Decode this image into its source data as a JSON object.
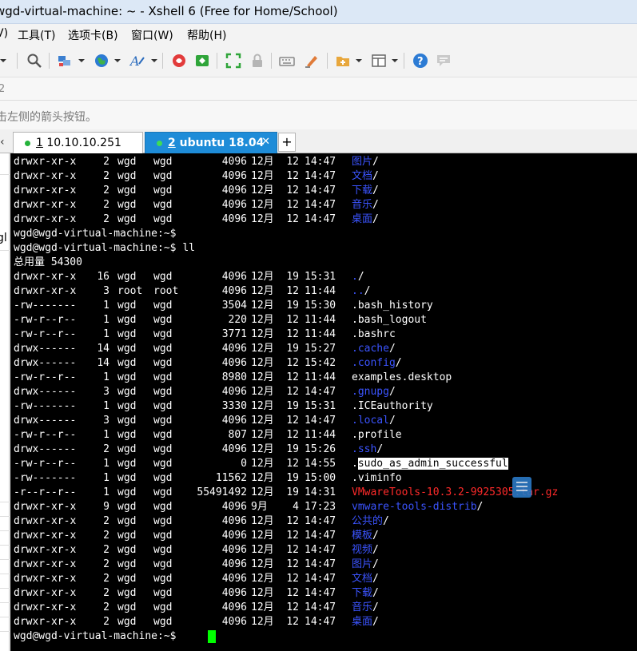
{
  "window": {
    "title": "wgd-virtual-machine: ~ - Xshell 6 (Free for Home/School)"
  },
  "menu": {
    "items": [
      "V)",
      "工具(T)",
      "选项卡(B)",
      "窗口(W)",
      "帮助(H)"
    ]
  },
  "toolbar": {
    "icons": [
      "dropdown-arrow",
      "search-icon",
      "session-properties-icon",
      "globe-icon",
      "font-icon",
      "xftp-icon",
      "xftp-green-icon",
      "fullscreen-icon",
      "lock-icon",
      "keyboard-icon",
      "highlighter-icon",
      "new-tab-icon",
      "layout-icon",
      "help-icon",
      "chat-icon"
    ]
  },
  "addressbar": {
    "text": "2"
  },
  "hint": {
    "text": "击左侧的箭头按钮。"
  },
  "tabs": [
    {
      "number": "1",
      "label": " 10.10.10.251",
      "close": "✕",
      "active": false
    },
    {
      "number": "2",
      "label": " ubuntu 18.04",
      "close": "✕",
      "active": true
    }
  ],
  "tab_add_label": "+",
  "tab_left_arrow": "‹",
  "sidepanel": {
    "partial_text": "gl"
  },
  "terminal": {
    "lines": [
      {
        "perm": "drwxr-xr-x",
        "links": "2",
        "owner": "wgd",
        "group": "wgd",
        "size": "4096",
        "month": "12月",
        "day": "12",
        "time": "14:47",
        "name": "图片",
        "suffix": "/",
        "type": "dir"
      },
      {
        "perm": "drwxr-xr-x",
        "links": "2",
        "owner": "wgd",
        "group": "wgd",
        "size": "4096",
        "month": "12月",
        "day": "12",
        "time": "14:47",
        "name": "文档",
        "suffix": "/",
        "type": "dir"
      },
      {
        "perm": "drwxr-xr-x",
        "links": "2",
        "owner": "wgd",
        "group": "wgd",
        "size": "4096",
        "month": "12月",
        "day": "12",
        "time": "14:47",
        "name": "下载",
        "suffix": "/",
        "type": "dir"
      },
      {
        "perm": "drwxr-xr-x",
        "links": "2",
        "owner": "wgd",
        "group": "wgd",
        "size": "4096",
        "month": "12月",
        "day": "12",
        "time": "14:47",
        "name": "音乐",
        "suffix": "/",
        "type": "dir"
      },
      {
        "perm": "drwxr-xr-x",
        "links": "2",
        "owner": "wgd",
        "group": "wgd",
        "size": "4096",
        "month": "12月",
        "day": "12",
        "time": "14:47",
        "name": "桌面",
        "suffix": "/",
        "type": "dir"
      },
      {
        "text": "wgd@wgd-virtual-machine:~$"
      },
      {
        "text": "wgd@wgd-virtual-machine:~$ ll"
      },
      {
        "text": "总用量 54300"
      },
      {
        "perm": "drwxr-xr-x",
        "links": "16",
        "owner": "wgd",
        "group": "wgd",
        "size": "4096",
        "month": "12月",
        "day": "19",
        "time": "15:31",
        "name": ".",
        "suffix": "/",
        "type": "dir"
      },
      {
        "perm": "drwxr-xr-x",
        "links": "3",
        "owner": "root",
        "group": "root",
        "size": "4096",
        "month": "12月",
        "day": "12",
        "time": "11:44",
        "name": "..",
        "suffix": "/",
        "type": "dir"
      },
      {
        "perm": "-rw-------",
        "links": "1",
        "owner": "wgd",
        "group": "wgd",
        "size": "3504",
        "month": "12月",
        "day": "19",
        "time": "15:30",
        "name": ".bash_history",
        "suffix": "",
        "type": "file"
      },
      {
        "perm": "-rw-r--r--",
        "links": "1",
        "owner": "wgd",
        "group": "wgd",
        "size": "220",
        "month": "12月",
        "day": "12",
        "time": "11:44",
        "name": ".bash_logout",
        "suffix": "",
        "type": "file"
      },
      {
        "perm": "-rw-r--r--",
        "links": "1",
        "owner": "wgd",
        "group": "wgd",
        "size": "3771",
        "month": "12月",
        "day": "12",
        "time": "11:44",
        "name": ".bashrc",
        "suffix": "",
        "type": "file"
      },
      {
        "perm": "drwx------",
        "links": "14",
        "owner": "wgd",
        "group": "wgd",
        "size": "4096",
        "month": "12月",
        "day": "19",
        "time": "15:27",
        "name": ".cache",
        "suffix": "/",
        "type": "dir"
      },
      {
        "perm": "drwx------",
        "links": "14",
        "owner": "wgd",
        "group": "wgd",
        "size": "4096",
        "month": "12月",
        "day": "12",
        "time": "15:42",
        "name": ".config",
        "suffix": "/",
        "type": "dir"
      },
      {
        "perm": "-rw-r--r--",
        "links": "1",
        "owner": "wgd",
        "group": "wgd",
        "size": "8980",
        "month": "12月",
        "day": "12",
        "time": "11:44",
        "name": "examples.desktop",
        "suffix": "",
        "type": "file"
      },
      {
        "perm": "drwx------",
        "links": "3",
        "owner": "wgd",
        "group": "wgd",
        "size": "4096",
        "month": "12月",
        "day": "12",
        "time": "14:47",
        "name": ".gnupg",
        "suffix": "/",
        "type": "dir"
      },
      {
        "perm": "-rw-------",
        "links": "1",
        "owner": "wgd",
        "group": "wgd",
        "size": "3330",
        "month": "12月",
        "day": "19",
        "time": "15:31",
        "name": ".ICEauthority",
        "suffix": "",
        "type": "file"
      },
      {
        "perm": "drwx------",
        "links": "3",
        "owner": "wgd",
        "group": "wgd",
        "size": "4096",
        "month": "12月",
        "day": "12",
        "time": "14:47",
        "name": ".local",
        "suffix": "/",
        "type": "dir"
      },
      {
        "perm": "-rw-r--r--",
        "links": "1",
        "owner": "wgd",
        "group": "wgd",
        "size": "807",
        "month": "12月",
        "day": "12",
        "time": "11:44",
        "name": ".profile",
        "suffix": "",
        "type": "file"
      },
      {
        "perm": "drwx------",
        "links": "2",
        "owner": "wgd",
        "group": "wgd",
        "size": "4096",
        "month": "12月",
        "day": "19",
        "time": "15:26",
        "name": ".ssh",
        "suffix": "/",
        "type": "dir"
      },
      {
        "perm": "-rw-r--r--",
        "links": "1",
        "owner": "wgd",
        "group": "wgd",
        "size": "0",
        "month": "12月",
        "day": "12",
        "time": "14:55",
        "name": ".sudo_as_admin_successful",
        "suffix": "",
        "type": "highlight"
      },
      {
        "perm": "-rw-------",
        "links": "1",
        "owner": "wgd",
        "group": "wgd",
        "size": "11562",
        "month": "12月",
        "day": "19",
        "time": "15:00",
        "name": ".viminfo",
        "suffix": "",
        "type": "file"
      },
      {
        "perm": "-r--r--r--",
        "links": "1",
        "owner": "wgd",
        "group": "wgd",
        "size": "55491492",
        "month": "12月",
        "day": "19",
        "time": "14:31",
        "name": "VMwareTools-10.3.2-9925305.tar.gz",
        "suffix": "",
        "type": "archive"
      },
      {
        "perm": "drwxr-xr-x",
        "links": "9",
        "owner": "wgd",
        "group": "wgd",
        "size": "4096",
        "month": "9月",
        "day": "4",
        "time": "17:23",
        "name": "vmware-tools-distrib",
        "suffix": "/",
        "type": "dir"
      },
      {
        "perm": "drwxr-xr-x",
        "links": "2",
        "owner": "wgd",
        "group": "wgd",
        "size": "4096",
        "month": "12月",
        "day": "12",
        "time": "14:47",
        "name": "公共的",
        "suffix": "/",
        "type": "dir"
      },
      {
        "perm": "drwxr-xr-x",
        "links": "2",
        "owner": "wgd",
        "group": "wgd",
        "size": "4096",
        "month": "12月",
        "day": "12",
        "time": "14:47",
        "name": "模板",
        "suffix": "/",
        "type": "dir"
      },
      {
        "perm": "drwxr-xr-x",
        "links": "2",
        "owner": "wgd",
        "group": "wgd",
        "size": "4096",
        "month": "12月",
        "day": "12",
        "time": "14:47",
        "name": "视频",
        "suffix": "/",
        "type": "dir"
      },
      {
        "perm": "drwxr-xr-x",
        "links": "2",
        "owner": "wgd",
        "group": "wgd",
        "size": "4096",
        "month": "12月",
        "day": "12",
        "time": "14:47",
        "name": "图片",
        "suffix": "/",
        "type": "dir"
      },
      {
        "perm": "drwxr-xr-x",
        "links": "2",
        "owner": "wgd",
        "group": "wgd",
        "size": "4096",
        "month": "12月",
        "day": "12",
        "time": "14:47",
        "name": "文档",
        "suffix": "/",
        "type": "dir"
      },
      {
        "perm": "drwxr-xr-x",
        "links": "2",
        "owner": "wgd",
        "group": "wgd",
        "size": "4096",
        "month": "12月",
        "day": "12",
        "time": "14:47",
        "name": "下载",
        "suffix": "/",
        "type": "dir"
      },
      {
        "perm": "drwxr-xr-x",
        "links": "2",
        "owner": "wgd",
        "group": "wgd",
        "size": "4096",
        "month": "12月",
        "day": "12",
        "time": "14:47",
        "name": "音乐",
        "suffix": "/",
        "type": "dir"
      },
      {
        "perm": "drwxr-xr-x",
        "links": "2",
        "owner": "wgd",
        "group": "wgd",
        "size": "4096",
        "month": "12月",
        "day": "12",
        "time": "14:47",
        "name": "桌面",
        "suffix": "/",
        "type": "dir"
      },
      {
        "text": "wgd@wgd-virtual-machine:~$",
        "cursor": true
      }
    ]
  },
  "colors": {
    "dir": "#3b54ff",
    "archive": "#ff2a2a",
    "cursor": "#00ff00",
    "active_tab": "#1e8cd8",
    "titlebar": "#dce8f6"
  }
}
